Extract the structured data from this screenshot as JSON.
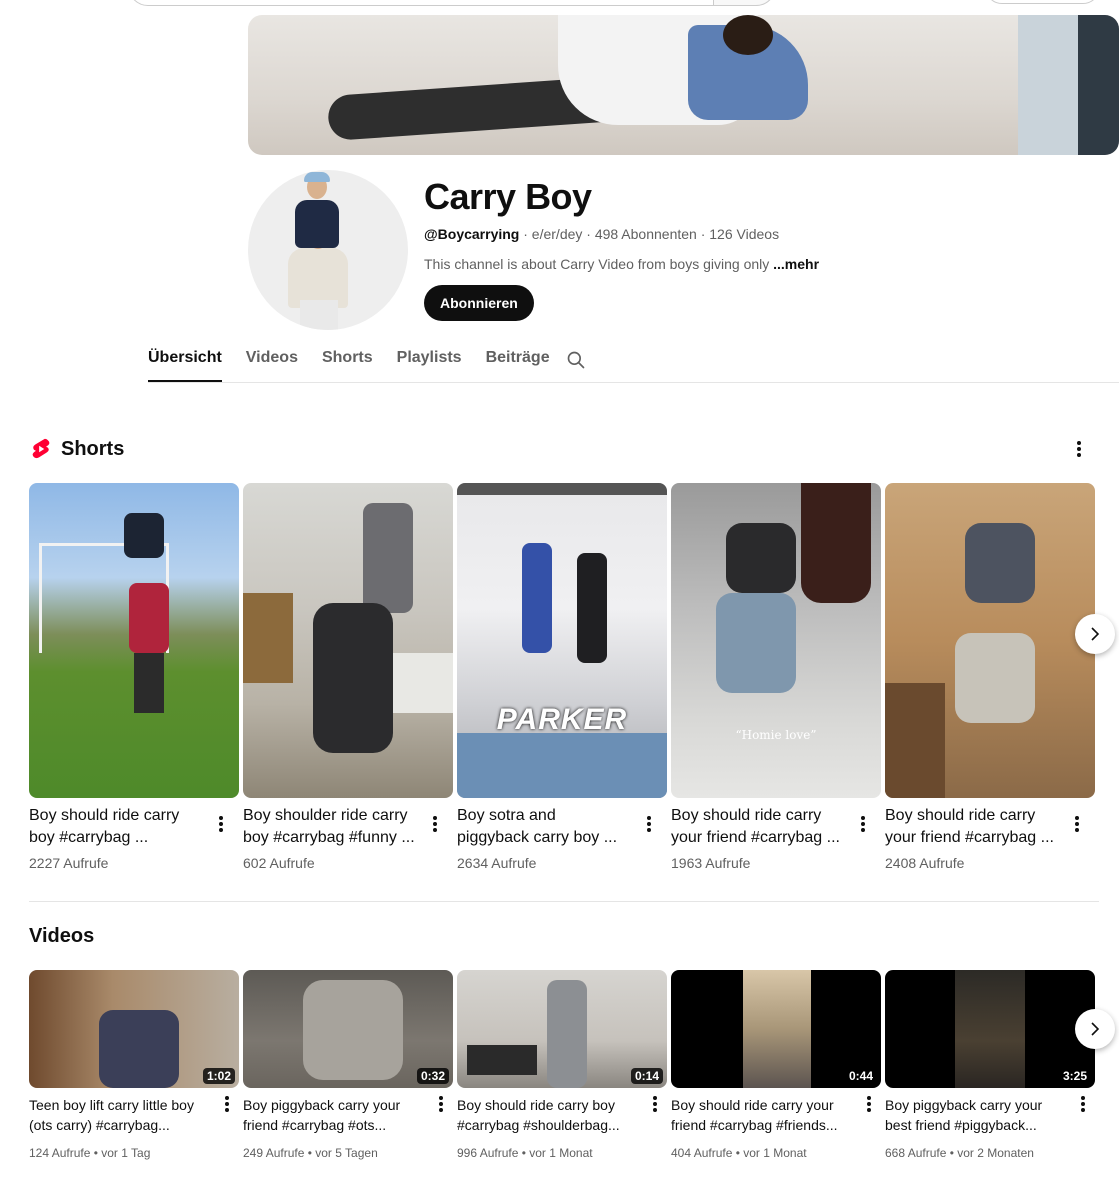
{
  "channel": {
    "name": "Carry Boy",
    "handle": "@Boycarrying",
    "meta": " · e/er/dey · 498 Abonnenten · 126 Videos",
    "description": "This channel is about Carry Video from boys giving only ",
    "more": "...mehr",
    "subscribe_label": "Abonnieren"
  },
  "tabs": [
    "Übersicht",
    "Videos",
    "Shorts",
    "Playlists",
    "Beiträge"
  ],
  "shorts": {
    "title": "Shorts",
    "items": [
      {
        "title_1": "Boy should ride carry",
        "title_2": "boy #carrybag ...",
        "views": "2227 Aufrufe"
      },
      {
        "title_1": "Boy shoulder ride carry",
        "title_2": "boy #carrybag #funny ...",
        "views": "602 Aufrufe"
      },
      {
        "title_1": "Boy sotra and",
        "title_2": "piggyback carry boy ...",
        "views": "2634 Aufrufe",
        "overlay": "PARKER"
      },
      {
        "title_1": "Boy should ride carry",
        "title_2": "your friend #carrybag ...",
        "views": "1963 Aufrufe",
        "overlay": "“Homie love”"
      },
      {
        "title_1": "Boy should ride carry",
        "title_2": "your friend #carrybag ...",
        "views": "2408 Aufrufe"
      }
    ]
  },
  "videos": {
    "title": "Videos",
    "items": [
      {
        "title_1": "Teen boy lift carry little boy",
        "title_2": "(ots carry) #carrybag...",
        "meta": "124 Aufrufe • vor 1 Tag",
        "duration": "1:02"
      },
      {
        "title_1": "Boy piggyback carry your",
        "title_2": "friend #carrybag #ots...",
        "meta": "249 Aufrufe • vor 5 Tagen",
        "duration": "0:32"
      },
      {
        "title_1": "Boy should ride carry boy",
        "title_2": "#carrybag #shoulderbag...",
        "meta": "996 Aufrufe • vor 1 Monat",
        "duration": "0:14"
      },
      {
        "title_1": "Boy should ride carry your",
        "title_2": "friend #carrybag #friends...",
        "meta": "404 Aufrufe • vor 1 Monat",
        "duration": "0:44"
      },
      {
        "title_1": "Boy piggyback carry your",
        "title_2": "best friend #piggyback...",
        "meta": "668 Aufrufe • vor 2 Monaten",
        "duration": "3:25"
      }
    ]
  },
  "colors": {
    "accent": "#ff0033",
    "text": "#0f0f0f",
    "muted": "#606060"
  }
}
